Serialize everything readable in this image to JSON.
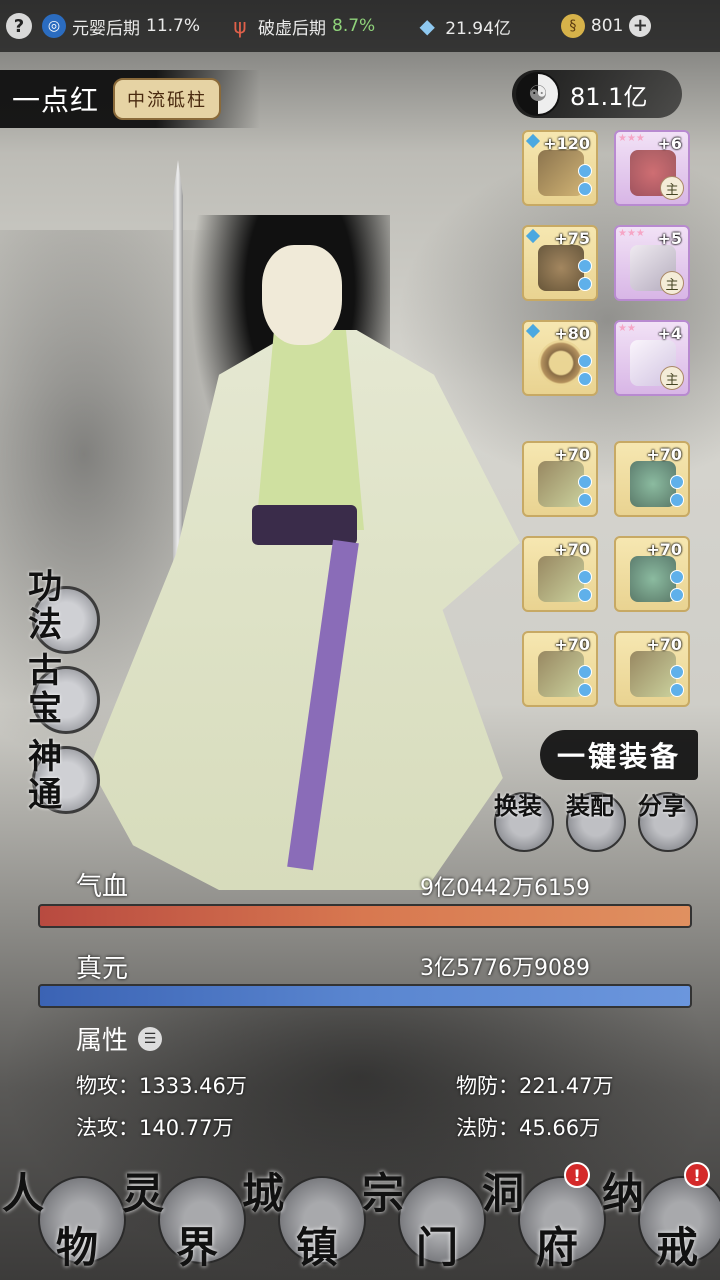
{
  "topbar": {
    "help": "?",
    "realm": {
      "label": "元婴后期",
      "value": "11.7%"
    },
    "tribulation": {
      "label": "破虚后期",
      "value": "8.7%"
    },
    "spirit_stones": "21.94亿",
    "gold": "801",
    "plus": "+"
  },
  "character": {
    "name": "一点红",
    "title": "中流砥柱",
    "power": "81.1亿"
  },
  "equipment": {
    "top": [
      {
        "level": "+120",
        "rarity": "gold",
        "icon": "brush-icon"
      },
      {
        "level": "+6",
        "rarity": "purple",
        "badge": "主",
        "icon": "fruit-icon"
      },
      {
        "level": "+75",
        "rarity": "gold",
        "icon": "beast-icon"
      },
      {
        "level": "+5",
        "rarity": "purple",
        "badge": "主",
        "icon": "feather-icon"
      },
      {
        "level": "+80",
        "rarity": "gold",
        "icon": "ring-icon"
      },
      {
        "level": "+4",
        "rarity": "purple",
        "badge": "主",
        "icon": "cloth-icon"
      }
    ],
    "bottom": [
      {
        "level": "+70",
        "icon": "flail-icon"
      },
      {
        "level": "+70",
        "icon": "statue-icon"
      },
      {
        "level": "+70",
        "icon": "flail-icon"
      },
      {
        "level": "+70",
        "icon": "statue-icon"
      },
      {
        "level": "+70",
        "icon": "flail-icon"
      },
      {
        "level": "+70",
        "icon": "flail-icon"
      }
    ]
  },
  "skills": {
    "gongfa": "功法",
    "gubao": "古宝",
    "shentong": "神通"
  },
  "actions": {
    "one_key_equip": "一键装备",
    "change_outfit": "换装",
    "match": "装配",
    "share": "分享"
  },
  "vitals": {
    "hp_label": "气血",
    "hp_value": "9亿0442万6159",
    "mp_label": "真元",
    "mp_value": "3亿5776万9089"
  },
  "attributes": {
    "header": "属性",
    "phys_atk_label": "物攻：",
    "phys_atk": "1333.46万",
    "phys_def_label": "物防：",
    "phys_def": "221.47万",
    "mag_atk_label": "法攻：",
    "mag_atk": "140.77万",
    "mag_def_label": "法防：",
    "mag_def": "45.66万"
  },
  "nav": [
    {
      "c1": "人",
      "c2": "物",
      "alert": false
    },
    {
      "c1": "灵",
      "c2": "界",
      "alert": false
    },
    {
      "c1": "城",
      "c2": "镇",
      "alert": false
    },
    {
      "c1": "宗",
      "c2": "门",
      "alert": false
    },
    {
      "c1": "洞",
      "c2": "府",
      "alert": true
    },
    {
      "c1": "纳",
      "c2": "戒",
      "alert": true
    }
  ],
  "colors": {
    "hp": "#d06a4c",
    "mp": "#4f78c6",
    "gold_slot": "#efdca0",
    "purple_slot": "#dcbaea"
  }
}
